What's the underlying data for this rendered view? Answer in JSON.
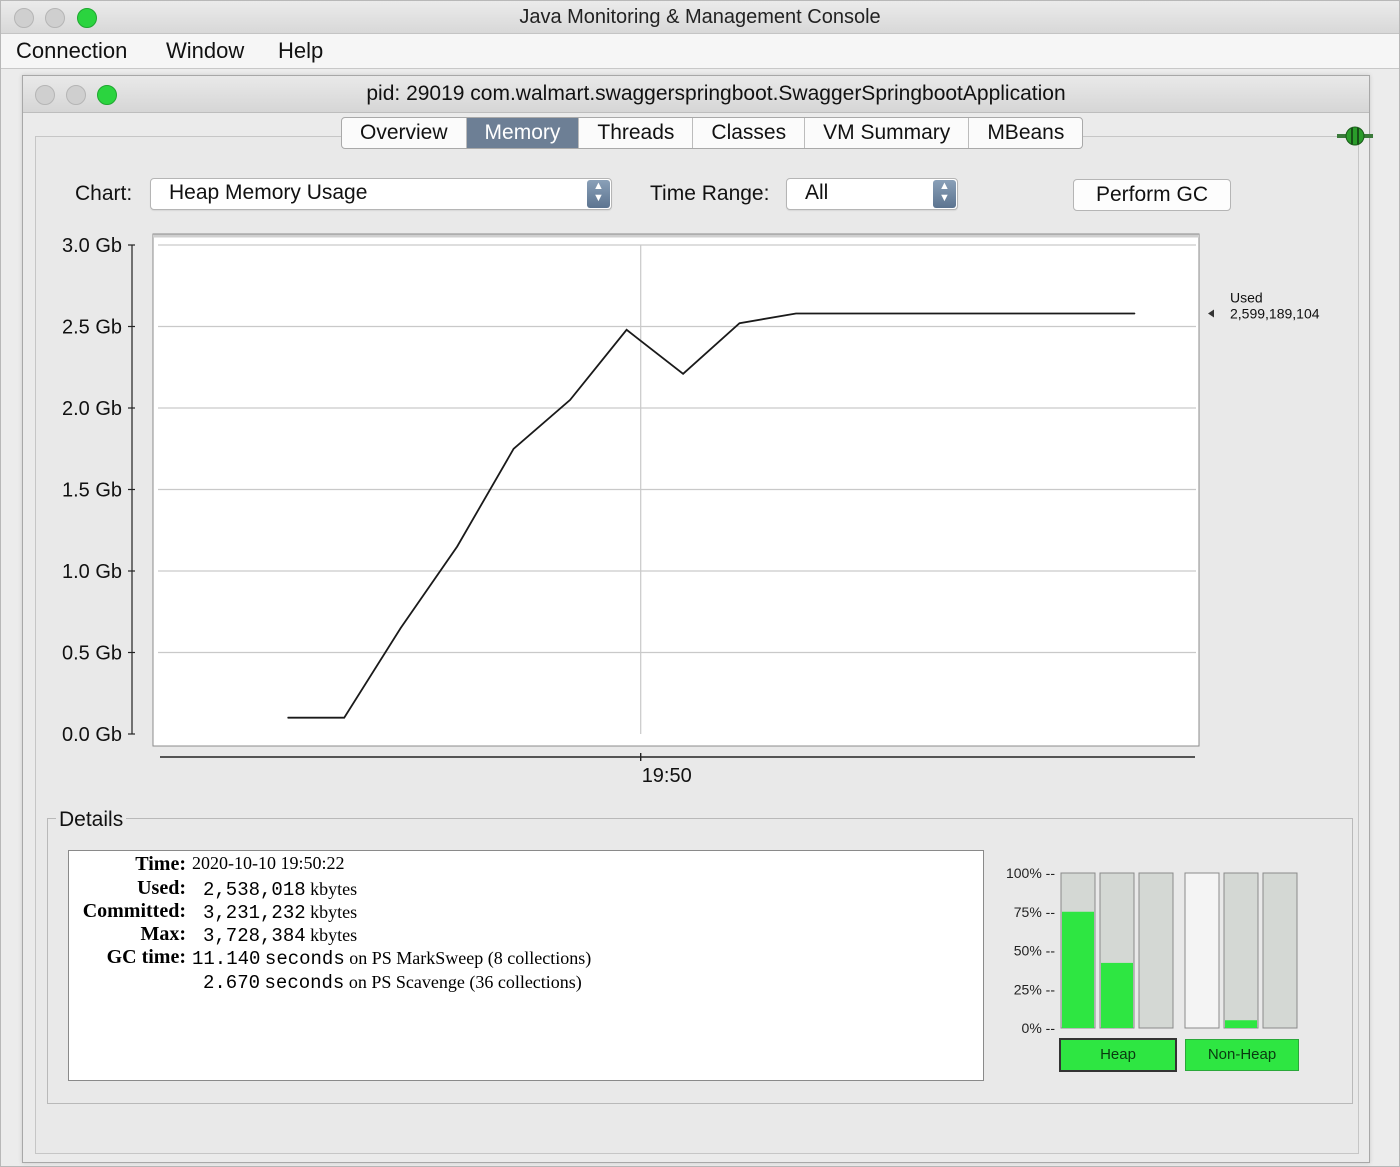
{
  "app": {
    "title": "Java Monitoring & Management Console"
  },
  "menubar": {
    "items": [
      "Connection",
      "Window",
      "Help"
    ]
  },
  "inner_window": {
    "title": "pid: 29019 com.walmart.swaggerspringboot.SwaggerSpringbootApplication"
  },
  "tabs": [
    {
      "label": "Overview",
      "active": false
    },
    {
      "label": "Memory",
      "active": true
    },
    {
      "label": "Threads",
      "active": false
    },
    {
      "label": "Classes",
      "active": false
    },
    {
      "label": "VM Summary",
      "active": false
    },
    {
      "label": "MBeans",
      "active": false
    }
  ],
  "controls": {
    "chart_label": "Chart:",
    "chart_value": "Heap Memory Usage",
    "time_range_label": "Time Range:",
    "time_range_value": "All",
    "perform_gc": "Perform GC"
  },
  "chart_data": {
    "type": "line",
    "series": [
      {
        "name": "Used",
        "x": [
          "19:47:55",
          "19:48:15",
          "19:48:35",
          "19:48:55",
          "19:49:15",
          "19:49:35",
          "19:49:55",
          "19:50:15",
          "19:50:35",
          "19:50:55",
          "19:51:15",
          "19:51:35",
          "19:51:55",
          "19:52:15",
          "19:52:35",
          "19:52:55"
        ],
        "y": [
          0.1,
          0.1,
          0.65,
          1.15,
          1.75,
          2.05,
          2.48,
          2.21,
          2.52,
          2.58,
          2.58,
          2.58,
          2.58,
          2.58,
          2.58,
          2.58
        ]
      }
    ],
    "ylim": [
      0,
      3.0
    ],
    "y_ticks": [
      "0.0 Gb",
      "0.5 Gb",
      "1.0 Gb",
      "1.5 Gb",
      "2.0 Gb",
      "2.5 Gb",
      "3.0 Gb"
    ],
    "y_tick_values": [
      0,
      0.5,
      1.0,
      1.5,
      2.0,
      2.5,
      3.0
    ],
    "x_tick": {
      "label": "19:50",
      "value": "19:50"
    },
    "grid": true,
    "legend": {
      "name": "Used",
      "value": "2,599,189,104",
      "placement": "right"
    }
  },
  "details": {
    "title": "Details",
    "time_label": "Time:",
    "time_value": "2020-10-10 19:50:22",
    "used_label": "Used:",
    "used_num": "2,538,018",
    "used_unit": "kbytes",
    "committed_label": "Committed:",
    "committed_num": "3,231,232",
    "committed_unit": "kbytes",
    "max_label": "Max:",
    "max_num": "3,728,384",
    "max_unit": "kbytes",
    "gc_label": "GC time:",
    "gc1_num": "11.140",
    "gc1_sec": "seconds",
    "gc1_text": "on PS MarkSweep (8 collections)",
    "gc2_num": "2.670",
    "gc2_sec": "seconds",
    "gc2_text": "on PS Scavenge (36 collections)"
  },
  "pools": {
    "ticks": [
      "100% --",
      "75% --",
      "50% --",
      "25% --",
      "0% --"
    ],
    "heap_label": "Heap",
    "nonheap_label": "Non-Heap",
    "heap_fill_pct": [
      75,
      42,
      0
    ],
    "nonheap_fill_pct": [
      0,
      5,
      0
    ],
    "heap_bg": [
      "#d4d8d4",
      "#d4d8d4",
      "#d4d8d4"
    ],
    "nonheap_bg": [
      "#f4f4f4",
      "#d4d8d4",
      "#d4d8d4"
    ],
    "fill_color": "#2ee642"
  },
  "colors": {
    "active_tab": "#6d7f95",
    "gauge_green": "#2ee642"
  }
}
